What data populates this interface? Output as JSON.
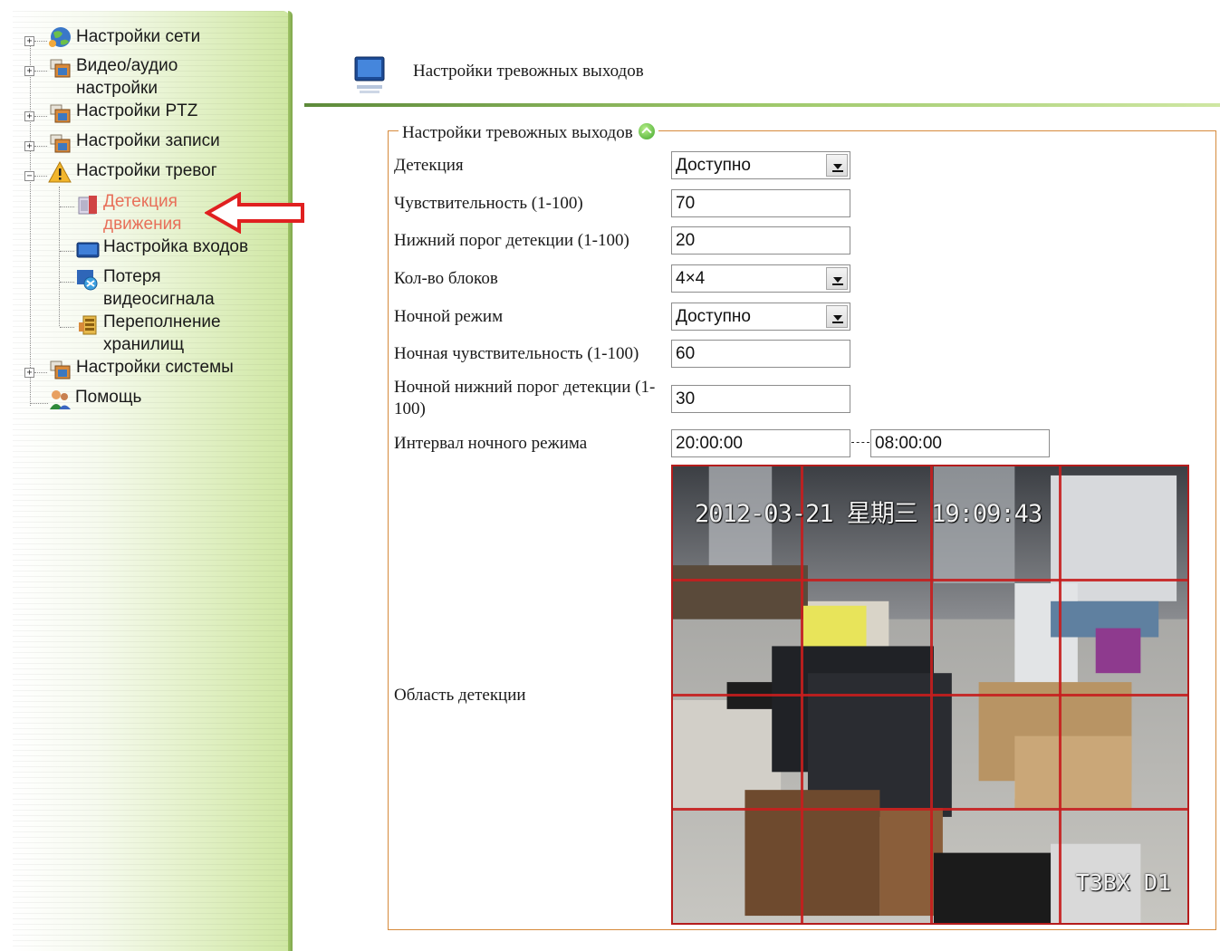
{
  "sidebar": {
    "items": [
      {
        "label": "Настройки сети",
        "icon": "globe-network-icon",
        "expander": "+"
      },
      {
        "label": "Видео/аудио",
        "label2": "настройки",
        "icon": "video-settings-icon",
        "expander": "+"
      },
      {
        "label": "Настройки PTZ",
        "icon": "ptz-settings-icon",
        "expander": "+"
      },
      {
        "label": "Настройки записи",
        "icon": "record-settings-icon",
        "expander": "+"
      },
      {
        "label": "Настройки тревог",
        "icon": "warning-triangle-icon",
        "expander": "−"
      },
      {
        "label": "Детекция",
        "label2": "движения",
        "icon": "motion-detection-icon",
        "active": true
      },
      {
        "label": "Настройка входов",
        "icon": "monitor-input-icon"
      },
      {
        "label": "Потеря",
        "label2": "видеосигнала",
        "icon": "video-loss-icon"
      },
      {
        "label": "Переполнение",
        "label2": "хранилищ",
        "icon": "storage-full-icon"
      },
      {
        "label": "Настройки системы",
        "icon": "system-settings-icon",
        "expander": "+"
      },
      {
        "label": "Помощь",
        "icon": "help-people-icon"
      }
    ]
  },
  "header": {
    "title": "Настройки тревожных выходов",
    "icon": "monitor-icon"
  },
  "form": {
    "legend": "Настройки тревожных выходов",
    "detection_label": "Детекция",
    "detection_value": "Доступно",
    "sensitivity_label": "Чувствительность (1-100)",
    "sensitivity_value": "70",
    "threshold_label": "Нижний порог детекции (1-100)",
    "threshold_value": "20",
    "blocks_label": "Кол-во блоков",
    "blocks_value": "4×4",
    "night_mode_label": "Ночной режим",
    "night_mode_value": "Доступно",
    "night_sensitivity_label": "Ночная чувствительность (1-100)",
    "night_sensitivity_value": "60",
    "night_threshold_label_1": "Ночной нижний порог детекции (1-",
    "night_threshold_label_2": "100)",
    "night_threshold_value": "30",
    "night_interval_label": "Интервал ночного режима",
    "night_interval_start": "20:00:00",
    "night_interval_separator": "---",
    "night_interval_end": "08:00:00",
    "area_label": "Область детекции"
  },
  "camera": {
    "osd_time": "2012-03-21 星期三 19:09:43",
    "osd_camera": "T3BX D1",
    "grid_rows": 4,
    "grid_cols": 4
  },
  "colors": {
    "grid": "#c61e1e",
    "fieldset_border": "#d68a3c",
    "active_item": "#e8705a",
    "annotation_arrow": "#e02020"
  }
}
